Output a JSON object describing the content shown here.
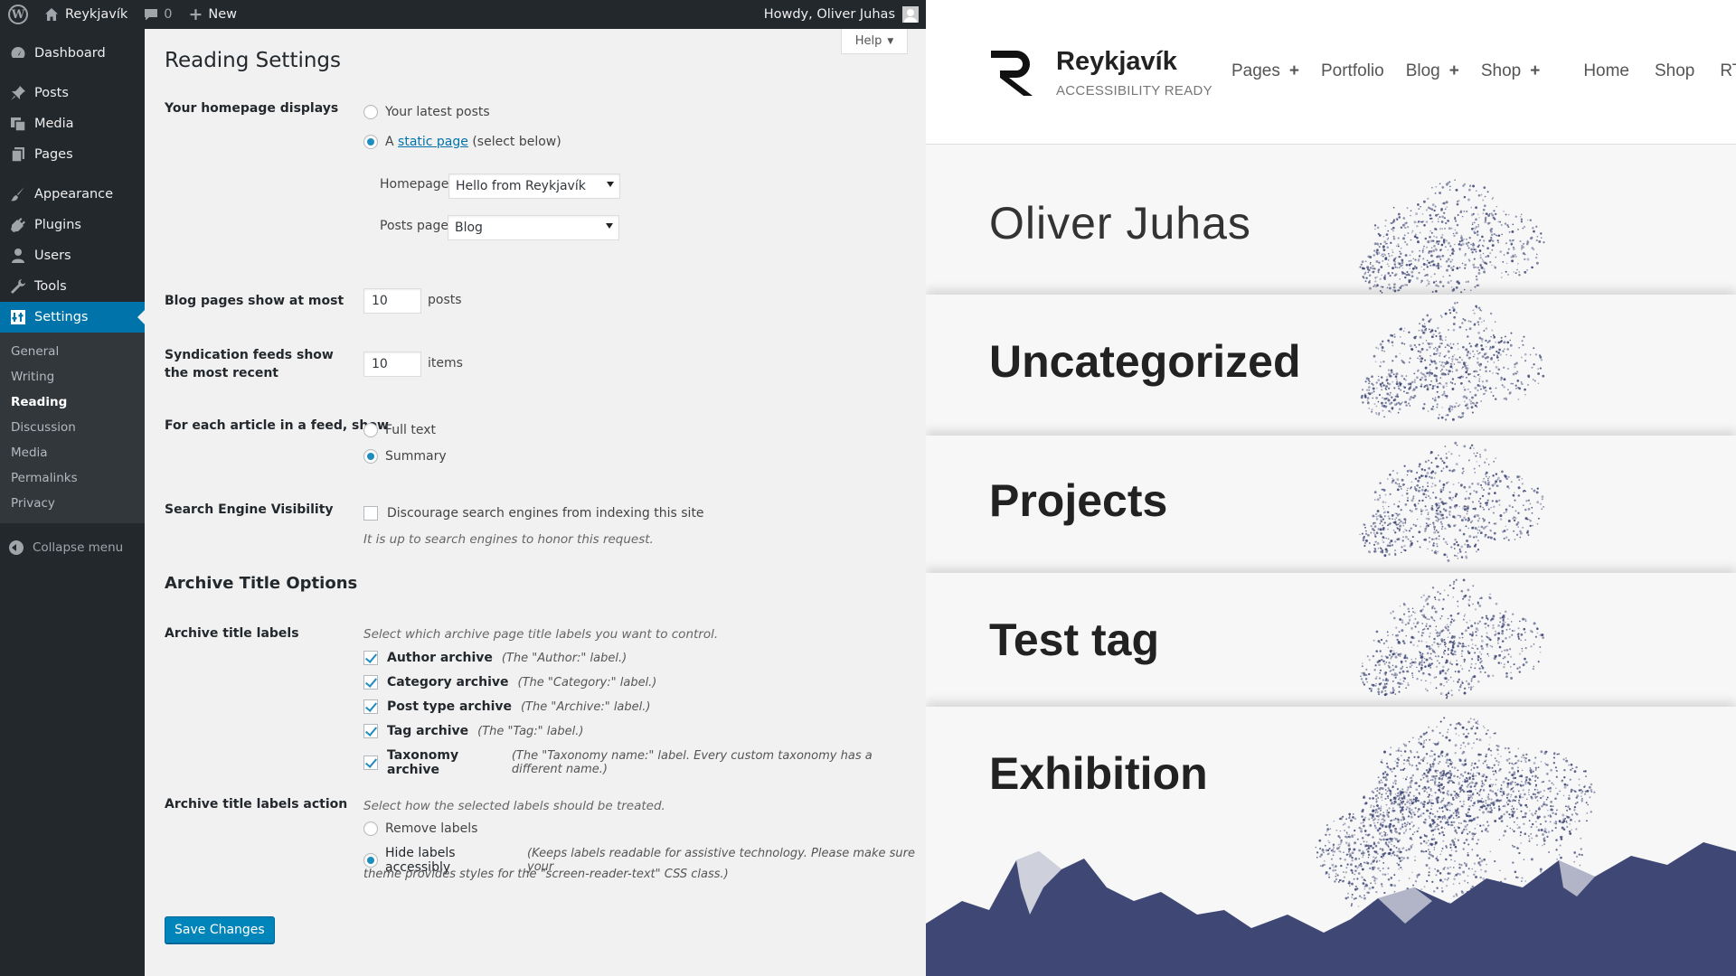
{
  "admin_bar": {
    "site_name": "Reykjavík",
    "comments_count": "0",
    "new_label": "New",
    "howdy": "Howdy, Oliver Juhas"
  },
  "menu": {
    "items": [
      {
        "label": "Dashboard",
        "icon": "dashboard-icon"
      },
      {
        "label": "Posts",
        "icon": "pin-icon"
      },
      {
        "label": "Media",
        "icon": "media-icon"
      },
      {
        "label": "Pages",
        "icon": "pages-icon"
      },
      {
        "label": "Appearance",
        "icon": "brush-icon"
      },
      {
        "label": "Plugins",
        "icon": "plug-icon"
      },
      {
        "label": "Users",
        "icon": "user-icon"
      },
      {
        "label": "Tools",
        "icon": "wrench-icon"
      },
      {
        "label": "Settings",
        "icon": "settings-icon"
      }
    ],
    "submenu": [
      "General",
      "Writing",
      "Reading",
      "Discussion",
      "Media",
      "Permalinks",
      "Privacy"
    ],
    "collapse_label": "Collapse menu"
  },
  "help_label": "Help",
  "page_title": "Reading Settings",
  "homepage": {
    "label": "Your homepage displays",
    "opt_latest": "Your latest posts",
    "opt_static_prefix": "A",
    "opt_static_link": "static page",
    "opt_static_suffix": "(select below)",
    "homepage_label": "Homepage:",
    "homepage_value": "Hello from Reykjavík",
    "posts_page_label": "Posts page:",
    "posts_page_value": "Blog"
  },
  "blog_pages": {
    "label": "Blog pages show at most",
    "value": "10",
    "unit": "posts"
  },
  "syndication": {
    "label": "Syndication feeds show the most recent",
    "value": "10",
    "unit": "items"
  },
  "feed_article": {
    "label": "For each article in a feed, show",
    "opt_full": "Full text",
    "opt_summary": "Summary"
  },
  "search_visibility": {
    "label": "Search Engine Visibility",
    "checkbox": "Discourage search engines from indexing this site",
    "description": "It is up to search engines to honor this request."
  },
  "archive": {
    "section_title": "Archive Title Options",
    "labels_label": "Archive title labels",
    "labels_description": "Select which archive page title labels you want to control.",
    "options": [
      {
        "name": "Author archive",
        "note": "(The \"Author:\" label.)"
      },
      {
        "name": "Category archive",
        "note": "(The \"Category:\" label.)"
      },
      {
        "name": "Post type archive",
        "note": "(The \"Archive:\" label.)"
      },
      {
        "name": "Tag archive",
        "note": "(The \"Tag:\" label.)"
      },
      {
        "name": "Taxonomy archive",
        "note": "(The \"Taxonomy name:\" label. Every custom taxonomy has a different name.)"
      }
    ],
    "action_label": "Archive title labels action",
    "action_description": "Select how the selected labels should be treated.",
    "opt_remove": "Remove labels",
    "opt_hide": "Hide labels accessibly",
    "opt_hide_note_1": "(Keeps labels readable for assistive technology. Please make sure your",
    "opt_hide_note_2": "theme provides styles for the \"screen-reader-text\" CSS class.)"
  },
  "save_label": "Save Changes",
  "preview": {
    "site_title": "Reykjavík",
    "site_description": "ACCESSIBILITY READY",
    "nav": [
      {
        "label": "Pages",
        "has_plus": true
      },
      {
        "label": "Portfolio",
        "has_plus": false
      },
      {
        "label": "Blog",
        "has_plus": true
      },
      {
        "label": "Shop",
        "has_plus": true
      },
      {
        "label": "Home",
        "has_plus": false
      },
      {
        "label": "Shop",
        "has_plus": false
      },
      {
        "label": "RT",
        "has_plus": false
      }
    ],
    "plus_sign": "+",
    "bands": [
      "Oliver Juhas",
      "Uncategorized",
      "Projects",
      "Test tag",
      "Exhibition"
    ],
    "illustration_color": "#3f4775"
  }
}
